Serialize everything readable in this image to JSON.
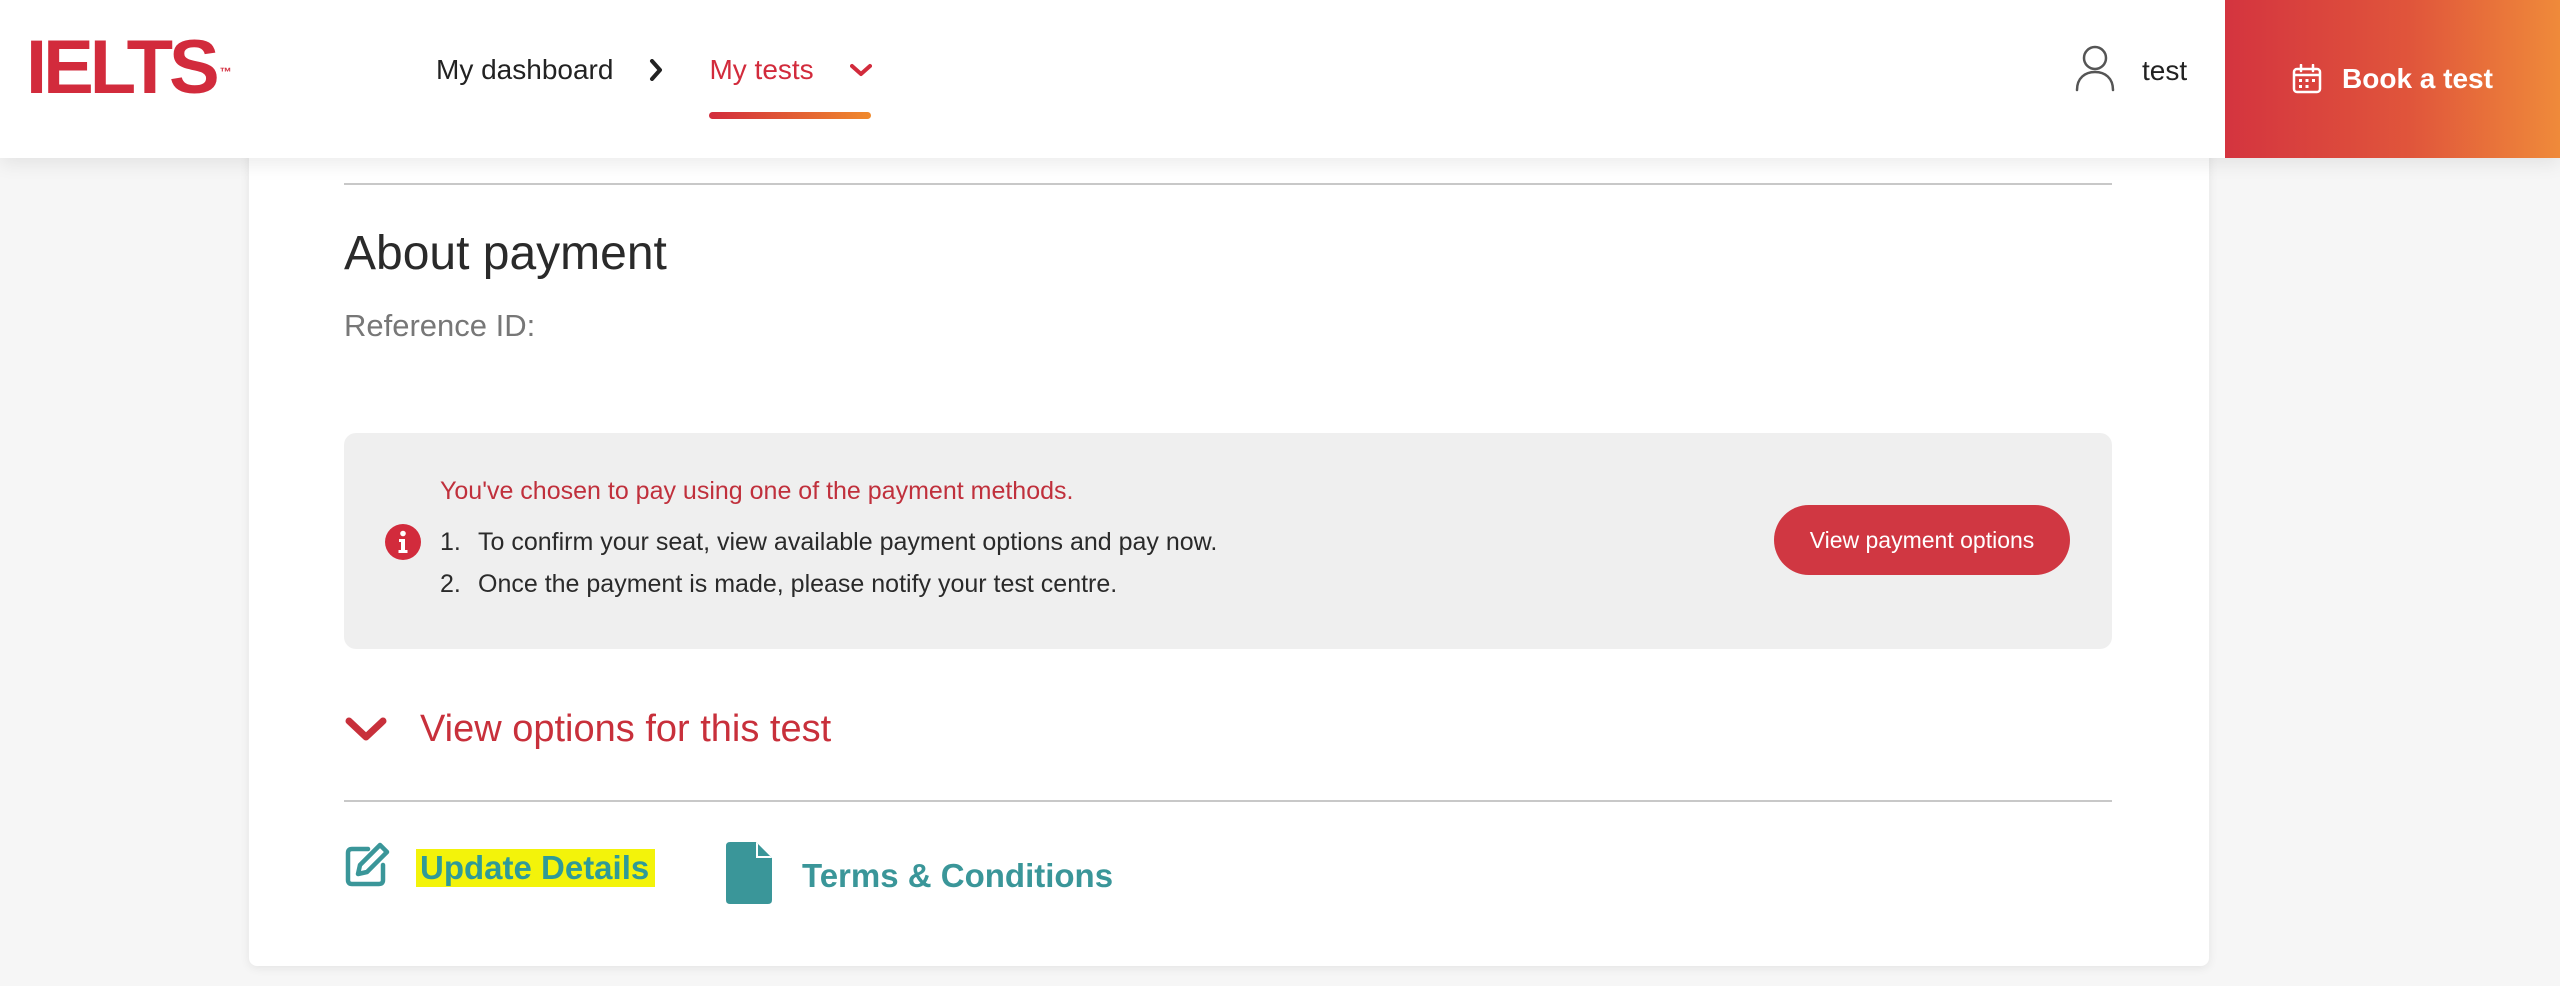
{
  "header": {
    "logo": "IELTS",
    "logo_tm": "™",
    "nav": {
      "dashboard": "My dashboard",
      "my_tests": "My tests"
    },
    "user": {
      "name": "test"
    },
    "book_button": "Book a test"
  },
  "payment": {
    "title": "About payment",
    "reference_label": "Reference ID:",
    "alert": {
      "heading": "You've chosen to pay using one of the payment methods.",
      "steps": [
        {
          "num": "1.",
          "text": "To confirm your seat, view available payment options and pay now."
        },
        {
          "num": "2.",
          "text": "Once the payment is made, please notify your test centre."
        }
      ],
      "button": "View payment options"
    },
    "options_toggle": "View options for this test",
    "actions": {
      "update": "Update Details",
      "terms": "Terms & Conditions"
    }
  },
  "colors": {
    "brand_red": "#d22b3c",
    "teal": "#3a9699",
    "highlight": "#f3f30a"
  },
  "icons": [
    "chevron-right-icon",
    "chevron-down-icon",
    "user-icon",
    "calendar-icon",
    "info-icon",
    "edit-icon",
    "document-icon"
  ]
}
